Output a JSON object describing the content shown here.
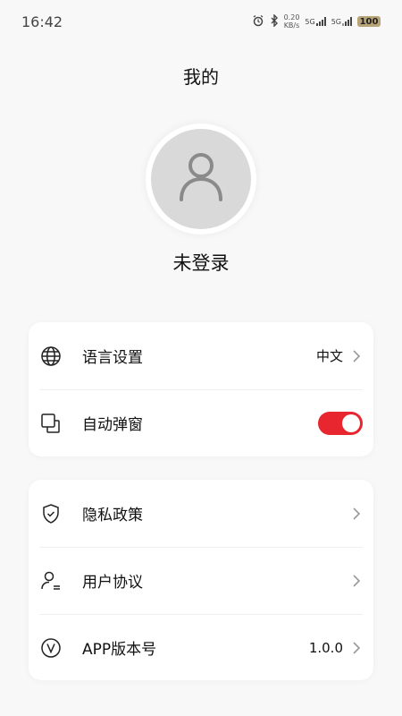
{
  "status_bar": {
    "time": "16:42",
    "speed_value": "0.20",
    "speed_unit": "KB/s",
    "net1": "5G",
    "net2": "5G",
    "battery": "100"
  },
  "header": {
    "title": "我的"
  },
  "profile": {
    "name": "未登录"
  },
  "settings_card": {
    "language": {
      "label": "语言设置",
      "value": "中文",
      "icon": "globe-icon"
    },
    "auto_popup": {
      "label": "自动弹窗",
      "enabled": true,
      "icon": "window-icon"
    }
  },
  "info_card": {
    "privacy": {
      "label": "隐私政策",
      "icon": "shield-check-icon"
    },
    "agreement": {
      "label": "用户协议",
      "icon": "user-doc-icon"
    },
    "version": {
      "label": "APP版本号",
      "value": "1.0.0",
      "icon": "version-v-icon"
    }
  },
  "colors": {
    "accent": "#e8262f",
    "avatar_bg": "#d9d9d9",
    "battery": "#b7a477"
  }
}
